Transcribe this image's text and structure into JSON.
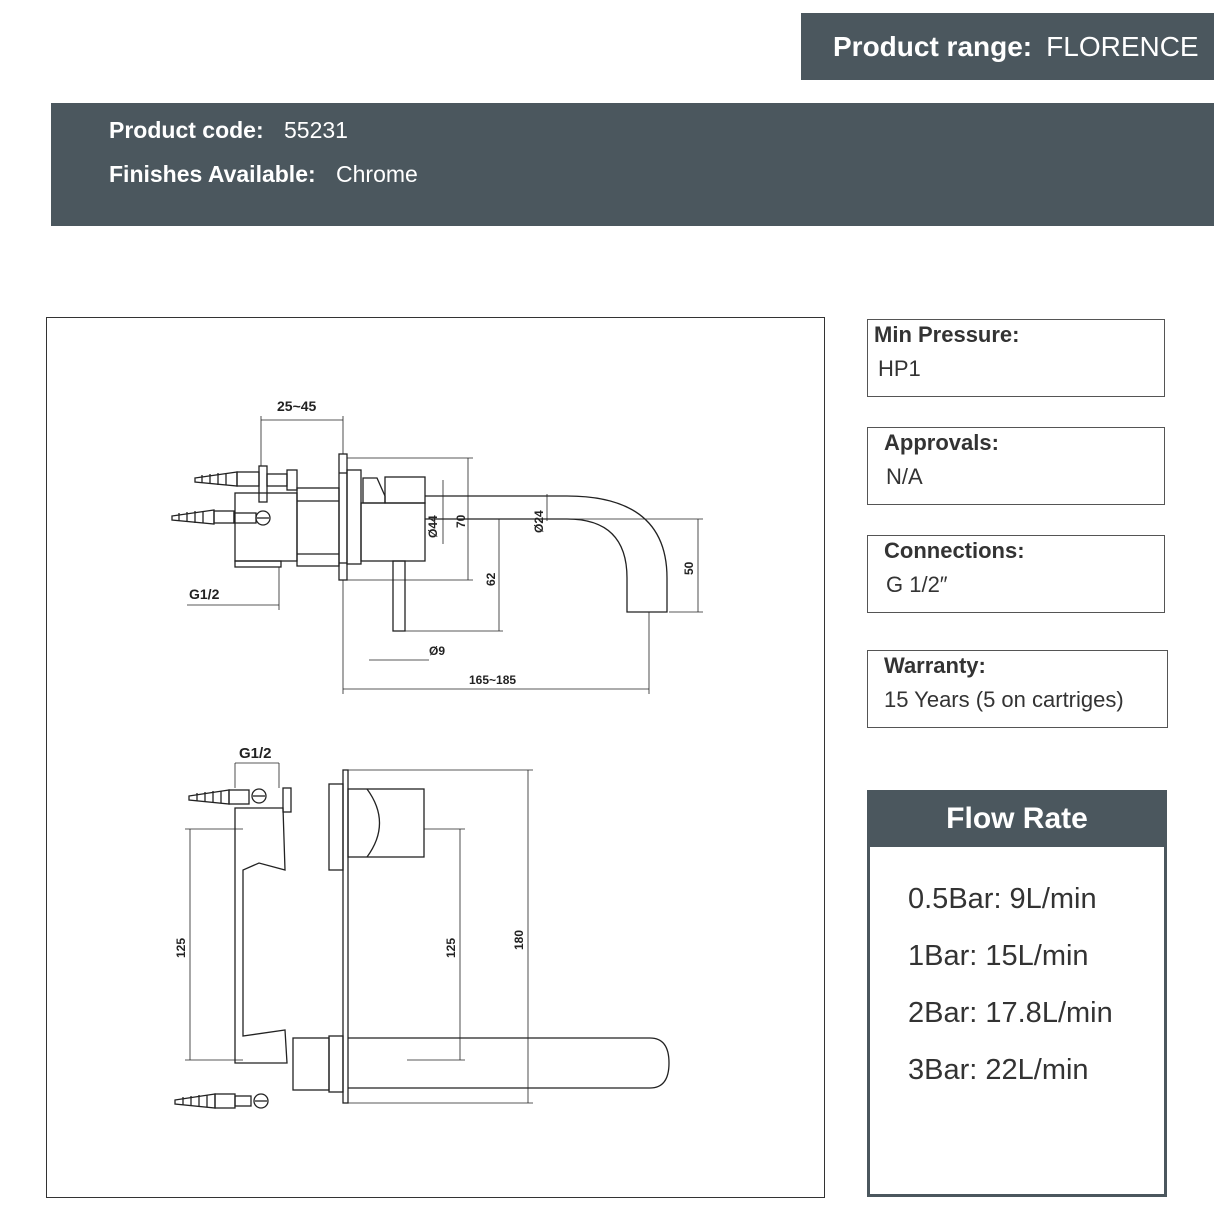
{
  "header": {
    "range_label": "Product range:",
    "range_value": "FLORENCE",
    "code_label": "Product code:",
    "code_value": "55231",
    "finish_label": "Finishes Available:",
    "finish_value": "Chrome"
  },
  "drawing": {
    "side_view": {
      "dim_depth": "25~45",
      "dim_thread": "G1/2",
      "dim_body_dia": "Ø44",
      "dim_height_70": "70",
      "dim_spout_dia": "Ø24",
      "dim_62": "62",
      "dim_50": "50",
      "dim_lever_dia": "Ø9",
      "dim_projection": "165~185"
    },
    "front_view": {
      "dim_thread": "G1/2",
      "dim_125_left": "125",
      "dim_125_right": "125",
      "dim_180": "180"
    }
  },
  "specs": [
    {
      "title": "Min Pressure:",
      "value": "HP1"
    },
    {
      "title": "Approvals:",
      "value": "N/A"
    },
    {
      "title": "Connections:",
      "value": "G 1/2″"
    },
    {
      "title": "Warranty:",
      "value": "15 Years (5 on cartriges)"
    }
  ],
  "flow_rate": {
    "title": "Flow Rate",
    "items": [
      "0.5Bar: 9L/min",
      "1Bar: 15L/min",
      "2Bar: 17.8L/min",
      "3Bar: 22L/min"
    ]
  }
}
